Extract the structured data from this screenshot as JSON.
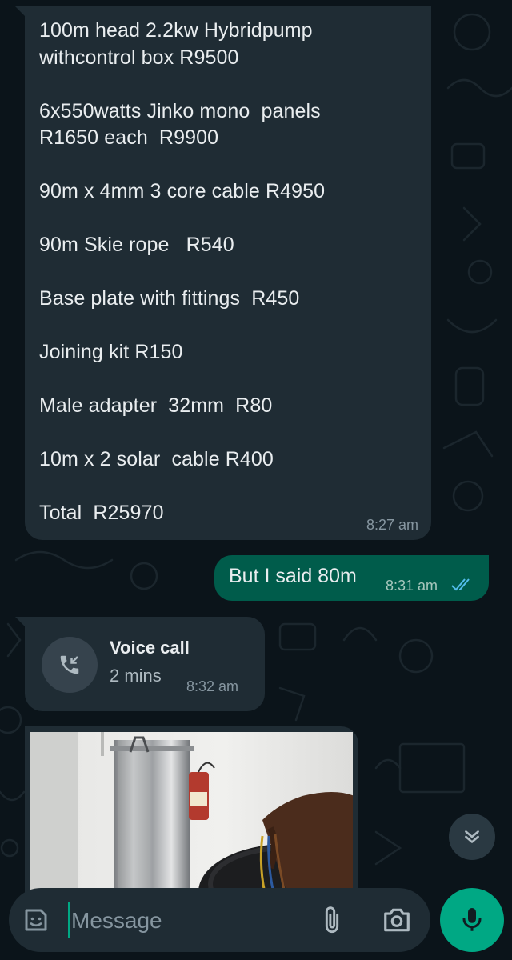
{
  "messages": {
    "quote": {
      "lines": [
        "100m head 2.2kw Hybridpump",
        "withcontrol box R9500",
        "",
        "6x550watts Jinko mono  panels",
        "R1650 each  R9900",
        "",
        "90m x 4mm 3 core cable R4950",
        "",
        "90m Skie rope   R540",
        "",
        "Base plate with fittings  R450",
        "",
        "Joining kit R150",
        "",
        "Male adapter  32mm  R80",
        "",
        "10m x 2 solar  cable R400",
        "",
        "Total  R25970"
      ],
      "time": "8:27 am"
    },
    "reply": {
      "text": "But I said 80m",
      "time": "8:31 am",
      "status": "read"
    },
    "call": {
      "title": "Voice call",
      "duration": "2 mins",
      "time": "8:32 am",
      "icon": "missed-call-incoming-icon"
    },
    "image": {
      "icon": "photo-thumbnail"
    }
  },
  "composer": {
    "placeholder": "Message"
  },
  "colors": {
    "background": "#0b141a",
    "incoming_bubble": "#1f2c34",
    "outgoing_bubble": "#005c4b",
    "accent": "#00a884",
    "read_ticks": "#53bdeb"
  }
}
